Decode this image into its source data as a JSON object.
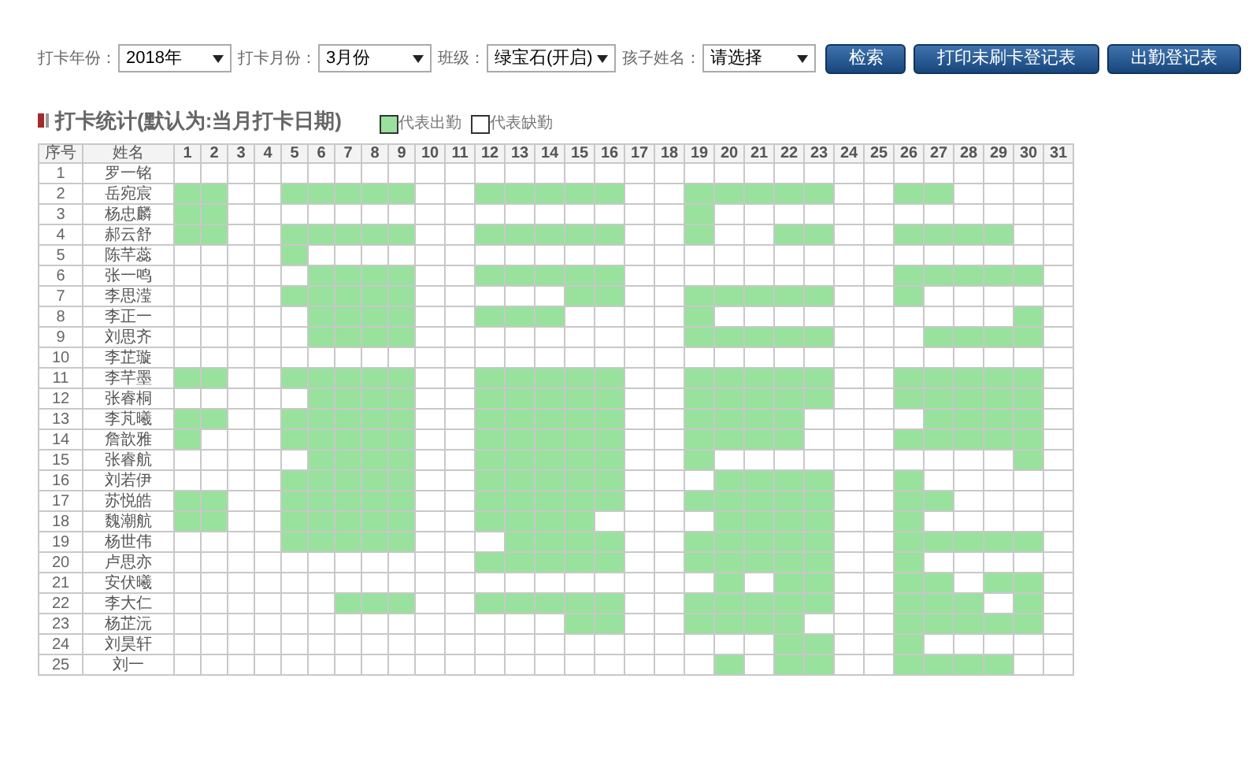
{
  "filters": [
    {
      "label": "打卡年份：",
      "value": "2018年"
    },
    {
      "label": "打卡月份：",
      "value": "3月份"
    },
    {
      "label": "班级：",
      "value": "绿宝石(开启)"
    },
    {
      "label": "孩子姓名：",
      "value": "请选择"
    }
  ],
  "buttons": [
    "检索",
    "打印未刷卡登记表",
    "出勤登记表"
  ],
  "section_title": "打卡统计(默认为:当月打卡日期)",
  "legend": [
    {
      "label": "代表出勤",
      "present": true
    },
    {
      "label": "代表缺勤",
      "present": false
    }
  ],
  "table": {
    "columns": [
      "序号",
      "姓名"
    ],
    "day_columns": [
      "1",
      "2",
      "3",
      "4",
      "5",
      "6",
      "7",
      "8",
      "9",
      "10",
      "11",
      "12",
      "13",
      "14",
      "15",
      "16",
      "17",
      "18",
      "19",
      "20",
      "21",
      "22",
      "23",
      "24",
      "25",
      "26",
      "27",
      "28",
      "29",
      "30",
      "31"
    ],
    "rows": [
      {
        "no": "1",
        "name": "罗一铭",
        "days": [
          false,
          false,
          false,
          false,
          false,
          false,
          false,
          false,
          false,
          false,
          false,
          false,
          false,
          false,
          false,
          false,
          false,
          false,
          false,
          false,
          false,
          false,
          false,
          false,
          false,
          false,
          false,
          false,
          false,
          false,
          false
        ]
      },
      {
        "no": "2",
        "name": "岳宛宸",
        "days": [
          true,
          true,
          false,
          false,
          true,
          true,
          true,
          true,
          true,
          false,
          false,
          true,
          true,
          true,
          true,
          true,
          false,
          false,
          true,
          true,
          true,
          true,
          true,
          false,
          false,
          true,
          true,
          false,
          false,
          false,
          false
        ]
      },
      {
        "no": "3",
        "name": "杨忠麟",
        "days": [
          true,
          true,
          false,
          false,
          false,
          false,
          false,
          false,
          false,
          false,
          false,
          false,
          false,
          false,
          false,
          false,
          false,
          false,
          true,
          false,
          false,
          false,
          false,
          false,
          false,
          false,
          false,
          false,
          false,
          false,
          false
        ]
      },
      {
        "no": "4",
        "name": "郝云舒",
        "days": [
          true,
          true,
          false,
          false,
          true,
          true,
          true,
          true,
          true,
          false,
          false,
          true,
          true,
          true,
          true,
          true,
          false,
          false,
          true,
          false,
          false,
          true,
          true,
          false,
          false,
          true,
          true,
          true,
          true,
          false,
          false
        ]
      },
      {
        "no": "5",
        "name": "陈芊蕊",
        "days": [
          false,
          false,
          false,
          false,
          true,
          false,
          false,
          false,
          false,
          false,
          false,
          false,
          false,
          false,
          false,
          false,
          false,
          false,
          false,
          false,
          false,
          false,
          false,
          false,
          false,
          false,
          false,
          false,
          false,
          false,
          false
        ]
      },
      {
        "no": "6",
        "name": "张一鸣",
        "days": [
          false,
          false,
          false,
          false,
          false,
          true,
          true,
          true,
          true,
          false,
          false,
          true,
          true,
          true,
          true,
          true,
          false,
          false,
          false,
          false,
          false,
          false,
          false,
          false,
          false,
          true,
          true,
          true,
          true,
          true,
          false
        ]
      },
      {
        "no": "7",
        "name": "李思滢",
        "days": [
          false,
          false,
          false,
          false,
          true,
          true,
          true,
          true,
          true,
          false,
          false,
          false,
          false,
          false,
          true,
          true,
          false,
          false,
          true,
          true,
          true,
          true,
          true,
          false,
          false,
          true,
          false,
          false,
          false,
          false,
          false
        ]
      },
      {
        "no": "8",
        "name": "李正一",
        "days": [
          false,
          false,
          false,
          false,
          false,
          true,
          true,
          true,
          true,
          false,
          false,
          true,
          true,
          true,
          false,
          false,
          false,
          false,
          true,
          false,
          false,
          false,
          false,
          false,
          false,
          false,
          false,
          false,
          false,
          true,
          false
        ]
      },
      {
        "no": "9",
        "name": "刘思齐",
        "days": [
          false,
          false,
          false,
          false,
          false,
          true,
          true,
          true,
          true,
          false,
          false,
          false,
          false,
          false,
          false,
          false,
          false,
          false,
          true,
          true,
          true,
          true,
          true,
          false,
          false,
          false,
          true,
          true,
          true,
          true,
          false
        ]
      },
      {
        "no": "10",
        "name": "李芷璇",
        "days": [
          false,
          false,
          false,
          false,
          false,
          false,
          false,
          false,
          false,
          false,
          false,
          false,
          false,
          false,
          false,
          false,
          false,
          false,
          false,
          false,
          false,
          false,
          false,
          false,
          false,
          false,
          false,
          false,
          false,
          false,
          false
        ]
      },
      {
        "no": "11",
        "name": "李芊墨",
        "days": [
          true,
          true,
          false,
          false,
          true,
          true,
          true,
          true,
          true,
          false,
          false,
          true,
          true,
          true,
          true,
          true,
          false,
          false,
          true,
          true,
          true,
          true,
          true,
          false,
          false,
          true,
          true,
          true,
          true,
          true,
          false
        ]
      },
      {
        "no": "12",
        "name": "张睿桐",
        "days": [
          false,
          false,
          false,
          false,
          false,
          true,
          true,
          true,
          true,
          false,
          false,
          true,
          true,
          true,
          true,
          true,
          false,
          false,
          true,
          true,
          true,
          true,
          true,
          false,
          false,
          true,
          true,
          true,
          true,
          true,
          false
        ]
      },
      {
        "no": "13",
        "name": "李芃曦",
        "days": [
          true,
          true,
          false,
          false,
          true,
          true,
          true,
          true,
          true,
          false,
          false,
          true,
          true,
          true,
          true,
          true,
          false,
          false,
          true,
          true,
          true,
          true,
          false,
          false,
          false,
          false,
          true,
          true,
          true,
          true,
          false
        ]
      },
      {
        "no": "14",
        "name": "詹歆雅",
        "days": [
          true,
          false,
          false,
          false,
          true,
          true,
          true,
          true,
          true,
          false,
          false,
          true,
          true,
          true,
          true,
          true,
          false,
          false,
          true,
          true,
          true,
          true,
          false,
          false,
          false,
          true,
          true,
          true,
          true,
          true,
          false
        ]
      },
      {
        "no": "15",
        "name": "张睿航",
        "days": [
          false,
          false,
          false,
          false,
          false,
          true,
          true,
          true,
          true,
          false,
          false,
          true,
          true,
          true,
          true,
          true,
          false,
          false,
          true,
          false,
          false,
          false,
          false,
          false,
          false,
          false,
          false,
          false,
          false,
          true,
          false
        ]
      },
      {
        "no": "16",
        "name": "刘若伊",
        "days": [
          false,
          false,
          false,
          false,
          true,
          true,
          true,
          true,
          true,
          false,
          false,
          true,
          true,
          true,
          true,
          true,
          false,
          false,
          false,
          true,
          true,
          true,
          true,
          false,
          false,
          true,
          false,
          false,
          false,
          false,
          false
        ]
      },
      {
        "no": "17",
        "name": "苏悦皓",
        "days": [
          true,
          true,
          false,
          false,
          true,
          true,
          true,
          true,
          true,
          false,
          false,
          true,
          true,
          true,
          true,
          true,
          false,
          false,
          true,
          true,
          true,
          true,
          true,
          false,
          false,
          true,
          true,
          false,
          false,
          false,
          false
        ]
      },
      {
        "no": "18",
        "name": "魏潮航",
        "days": [
          true,
          true,
          false,
          false,
          true,
          true,
          true,
          true,
          true,
          false,
          false,
          true,
          true,
          true,
          true,
          false,
          false,
          false,
          false,
          true,
          true,
          true,
          true,
          false,
          false,
          true,
          false,
          false,
          false,
          false,
          false
        ]
      },
      {
        "no": "19",
        "name": "杨世伟",
        "days": [
          false,
          false,
          false,
          false,
          true,
          true,
          true,
          true,
          true,
          false,
          false,
          false,
          true,
          true,
          true,
          true,
          false,
          false,
          true,
          true,
          true,
          true,
          true,
          false,
          false,
          true,
          true,
          true,
          true,
          true,
          false
        ]
      },
      {
        "no": "20",
        "name": "卢思亦",
        "days": [
          false,
          false,
          false,
          false,
          false,
          false,
          false,
          false,
          false,
          false,
          false,
          true,
          true,
          true,
          true,
          true,
          false,
          false,
          true,
          true,
          true,
          true,
          true,
          false,
          false,
          true,
          false,
          false,
          false,
          false,
          false
        ]
      },
      {
        "no": "21",
        "name": "安伏曦",
        "days": [
          false,
          false,
          false,
          false,
          false,
          false,
          false,
          false,
          false,
          false,
          false,
          false,
          false,
          false,
          false,
          false,
          false,
          false,
          false,
          true,
          false,
          true,
          true,
          false,
          false,
          true,
          true,
          false,
          true,
          true,
          false
        ]
      },
      {
        "no": "22",
        "name": "李大仁",
        "days": [
          false,
          false,
          false,
          false,
          false,
          false,
          true,
          true,
          true,
          false,
          false,
          true,
          true,
          true,
          true,
          true,
          false,
          false,
          true,
          true,
          true,
          true,
          true,
          false,
          false,
          true,
          true,
          true,
          false,
          true,
          false
        ]
      },
      {
        "no": "23",
        "name": "杨芷沅",
        "days": [
          false,
          false,
          false,
          false,
          false,
          false,
          false,
          false,
          false,
          false,
          false,
          false,
          false,
          false,
          true,
          true,
          false,
          false,
          true,
          true,
          true,
          true,
          false,
          false,
          false,
          true,
          true,
          true,
          true,
          true,
          false
        ]
      },
      {
        "no": "24",
        "name": "刘昊轩",
        "days": [
          false,
          false,
          false,
          false,
          false,
          false,
          false,
          false,
          false,
          false,
          false,
          false,
          false,
          false,
          false,
          false,
          false,
          false,
          false,
          false,
          false,
          true,
          true,
          false,
          false,
          true,
          false,
          false,
          false,
          false,
          false
        ]
      },
      {
        "no": "25",
        "name": "刘一",
        "days": [
          false,
          false,
          false,
          false,
          false,
          false,
          false,
          false,
          false,
          false,
          false,
          false,
          false,
          false,
          false,
          false,
          false,
          false,
          false,
          true,
          false,
          true,
          true,
          false,
          false,
          true,
          true,
          true,
          true,
          false,
          false
        ]
      }
    ]
  }
}
